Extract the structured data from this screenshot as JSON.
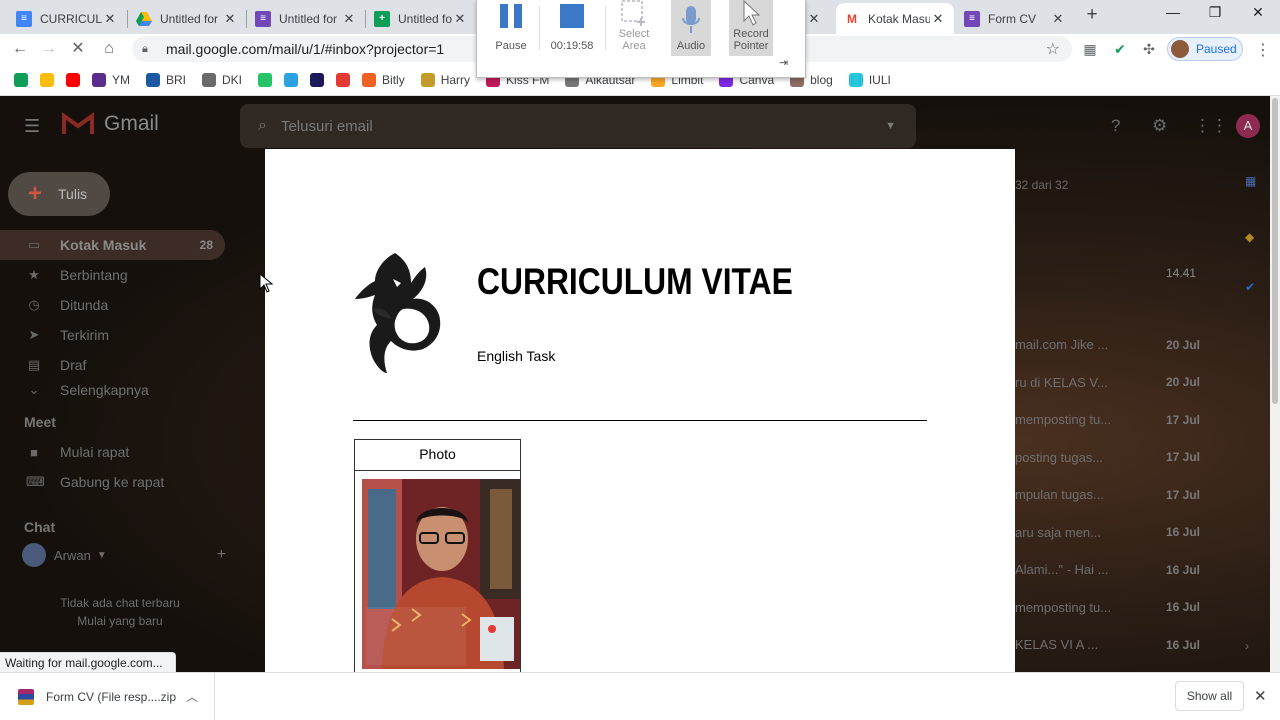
{
  "tabs": [
    {
      "title": "CURRICULU",
      "favicon_color": "#4285f4"
    },
    {
      "title": "Untitled for",
      "favicon_color": "#fbbc04"
    },
    {
      "title": "Untitled for",
      "favicon_color": "#7248b9"
    },
    {
      "title": "Untitled for",
      "favicon_color": "#0f9d58"
    },
    {
      "title": "Kotak Masu",
      "favicon_color": "#ea4335"
    },
    {
      "title": "Form CV",
      "favicon_color": "#7248b9"
    }
  ],
  "toolbar": {
    "url": "mail.google.com/mail/u/1/#inbox?projector=1",
    "profile_status": "Paused"
  },
  "bookmarks": [
    {
      "label": "",
      "color": "#0f9d58"
    },
    {
      "label": "",
      "color": "#fbbc04"
    },
    {
      "label": "",
      "color": "#ff0000"
    },
    {
      "label": "YM",
      "color": "#5a2b8a"
    },
    {
      "label": "BRI",
      "color": "#1a5aa5"
    },
    {
      "label": "DKI",
      "color": "#6a6a6a"
    },
    {
      "label": "",
      "color": "#25c466"
    },
    {
      "label": "",
      "color": "#2aa3e0"
    },
    {
      "label": "",
      "color": "#1a1a5a"
    },
    {
      "label": "",
      "color": "#e53935"
    },
    {
      "label": "Bitly",
      "color": "#ee6123"
    },
    {
      "label": "Harry",
      "color": "#c49a2a"
    },
    {
      "label": "Kiss FM",
      "color": "#c2185b"
    },
    {
      "label": "Alkautsar",
      "color": "#777777"
    },
    {
      "label": "Limbit",
      "color": "#f9a825"
    },
    {
      "label": "Canva",
      "color": "#7d2ae8"
    },
    {
      "label": "blog",
      "color": "#8d6e63"
    },
    {
      "label": "IULI",
      "color": "#26c6da"
    }
  ],
  "recorder": {
    "pause_label": "Pause",
    "timer": "00:19:58",
    "select_area_label": "Select Area",
    "audio_label": "Audio",
    "record_pointer_label": "Record Pointer"
  },
  "gmail": {
    "logo": "Gmail",
    "search_placeholder": "Telusuri email",
    "compose_label": "Tulis",
    "nav": [
      {
        "label": "Kotak Masuk",
        "count": "28",
        "icon": "inbox-icon"
      },
      {
        "label": "Berbintang",
        "count": "",
        "icon": "star-icon"
      },
      {
        "label": "Ditunda",
        "count": "",
        "icon": "clock-icon"
      },
      {
        "label": "Terkirim",
        "count": "",
        "icon": "send-icon"
      },
      {
        "label": "Draf",
        "count": "",
        "icon": "draft-icon"
      },
      {
        "label": "Selengkapnya",
        "count": "",
        "icon": "chevron-down-icon"
      }
    ],
    "meet_label": "Meet",
    "meet_items": [
      {
        "label": "Mulai rapat",
        "icon": "video-icon"
      },
      {
        "label": "Gabung ke rapat",
        "icon": "keyboard-icon"
      }
    ],
    "chat_label": "Chat",
    "chat_user": "Arwan",
    "chat_empty_line1": "Tidak ada chat terbaru",
    "chat_empty_line2": "Mulai yang baru",
    "page_info": "32 dari 32",
    "top_time": "14.41",
    "rows": [
      {
        "snippet": "mail.com Jike ...",
        "date": "20 Jul"
      },
      {
        "snippet": "ru di KELAS V...",
        "date": "20 Jul"
      },
      {
        "snippet": "memposting tu...",
        "date": "17 Jul"
      },
      {
        "snippet": "posting tugas...",
        "date": "17 Jul"
      },
      {
        "snippet": "mpulan tugas...",
        "date": "17 Jul"
      },
      {
        "snippet": "aru saja men...",
        "date": "16 Jul"
      },
      {
        "snippet": "Alami...\" - Hai ...",
        "date": "16 Jul"
      },
      {
        "snippet": "memposting tu...",
        "date": "16 Jul"
      },
      {
        "snippet": "KELAS VI A ...",
        "date": "16 Jul"
      }
    ]
  },
  "cv": {
    "title": "CURRICULUM VITAE",
    "subtitle": "English Task",
    "photo_label": "Photo"
  },
  "status": {
    "text": "Waiting for mail.google.com..."
  },
  "downloads": {
    "file": "Form CV (File resp....zip",
    "show_all": "Show all"
  }
}
